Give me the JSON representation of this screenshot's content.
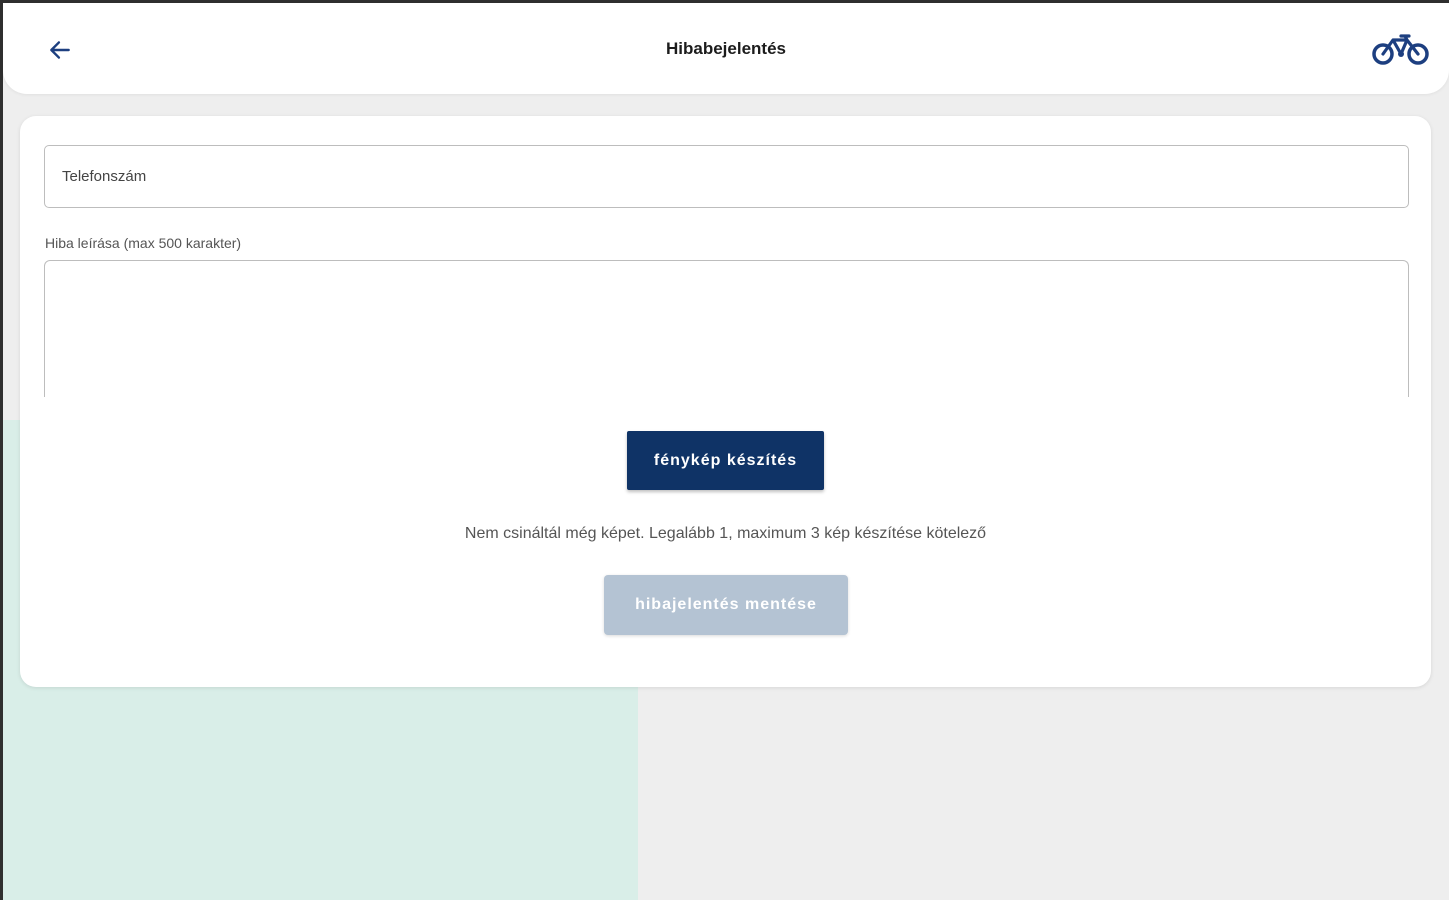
{
  "header": {
    "title": "Hibabejelentés",
    "back_icon": "arrow-left-icon",
    "logo_icon": "bicycle-icon",
    "accent_color": "#1d3f80"
  },
  "form": {
    "phone_placeholder": "Telefonszám",
    "phone_value": "",
    "description_label": "Hiba leírása (max 500 karakter)",
    "description_value": "",
    "photo_button_label": "fénykép készítés",
    "photo_info": "Nem csináltál még képet. Legalább 1, maximum 3 kép készítése kötelező",
    "save_button_label": "hibajelentés mentése",
    "save_enabled": false
  },
  "colors": {
    "primary": "#0f3366",
    "disabled": "#b4c3d3",
    "background": "#eeeeee",
    "map_green": "#d9eee8"
  }
}
